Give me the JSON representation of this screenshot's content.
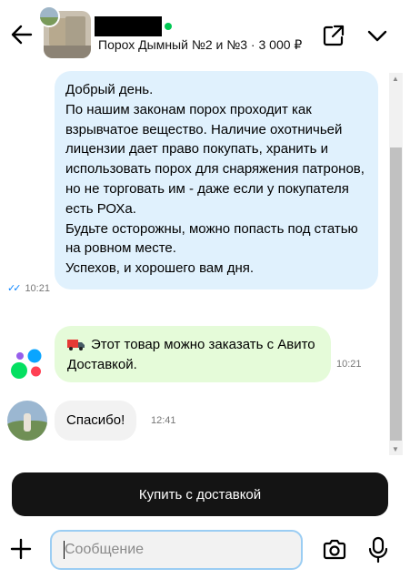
{
  "header": {
    "title": "Порох Дымный №2 и №3 · 3 000 ₽",
    "online": true
  },
  "messages": {
    "outgoing": {
      "lines": [
        "Добрый день.",
        "По нашим законам порох проходит как взрывчатое вещество. Наличие охотничьей лицензии дает право покупать, хранить и использовать порох для снаряжения патронов, но не торговать им - даже если у покупателя есть РОХа.",
        "Будьте осторожны, можно попасть под статью на ровном месте.",
        "Успехов, и хорошего вам дня."
      ],
      "time": "10:21"
    },
    "system": {
      "text": "Этот товар можно заказать с Авито Доставкой.",
      "time": "10:21"
    },
    "incoming": {
      "text": "Спасибо!",
      "time": "12:41"
    }
  },
  "footer": {
    "buy_label": "Купить с доставкой",
    "message_placeholder": "Сообщение"
  },
  "colors": {
    "outgoing_bubble": "#e0f1fd",
    "system_bubble": "#e5fbd9",
    "incoming_bubble": "#f2f2f2",
    "online": "#00c853",
    "read_ticks": "#0a84ff",
    "button": "#141414"
  }
}
